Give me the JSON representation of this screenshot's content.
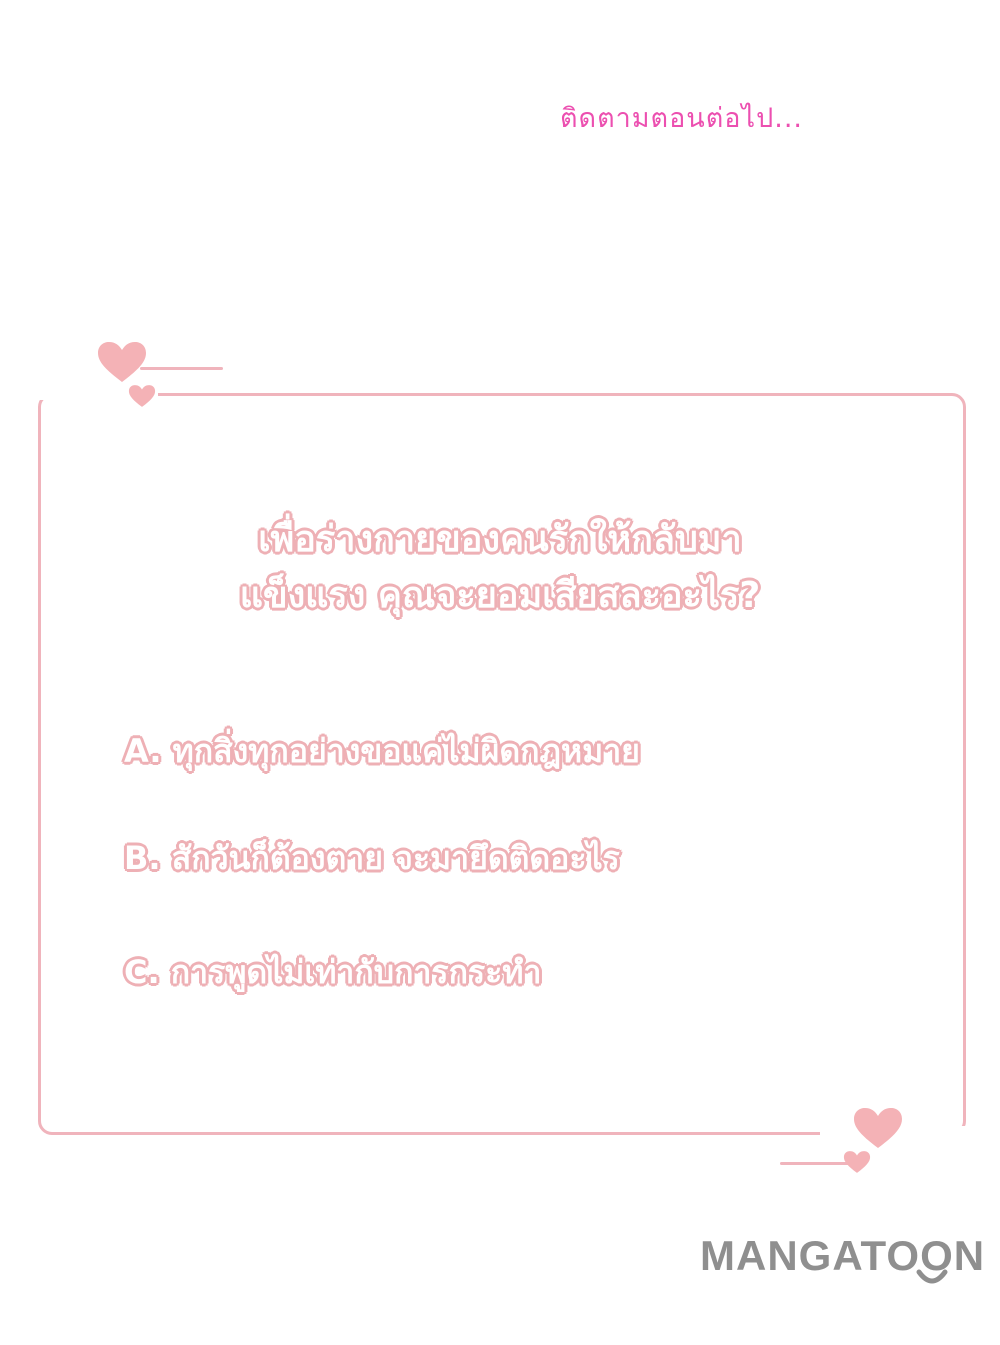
{
  "header": {
    "to_be_continued": "ติดตามตอนต่อไป..."
  },
  "question": {
    "line1": "เพื่อร่างกายของคนรักให้กลับมา",
    "line2": "แข็งแรง คุณจะยอมเสียสละอะไร?"
  },
  "options": [
    {
      "label": "A. ทุกสิ่งทุกอย่างขอแค่ไม่ผิดกฎหมาย"
    },
    {
      "label": "B. สักวันก็ต้องตาย จะมายึดติดอะไร"
    },
    {
      "label": "C. การพูดไม่เท่ากับการกระทำ"
    }
  ],
  "watermark": {
    "logo_text": "MANGATOON"
  },
  "colors": {
    "title_pink": "#ec4fb0",
    "frame_pink": "#f0b4bc",
    "heart_pink": "#f4b2b6",
    "text_outline": "#eeb0b5",
    "logo_gray": "#8f8f8f"
  },
  "icons": [
    "heart-icon",
    "smile-icon"
  ]
}
